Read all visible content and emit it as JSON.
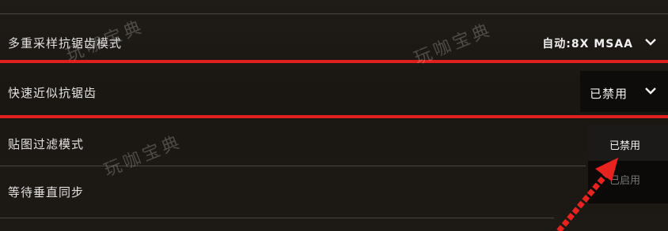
{
  "settings": [
    {
      "label": "多重采样抗锯齿模式",
      "value": "自动:8X MSAA"
    },
    {
      "label": "快速近似抗锯齿",
      "value": "已禁用"
    },
    {
      "label": "贴图过滤模式",
      "value": ""
    },
    {
      "label": "等待垂直同步",
      "value": ""
    }
  ],
  "dropdown": {
    "options": [
      "已禁用",
      "已启用"
    ]
  },
  "watermark": "玩咖宝典",
  "colors": {
    "highlight": "#e0201e",
    "background": "#1c1814",
    "arrow": "#e8231f"
  }
}
